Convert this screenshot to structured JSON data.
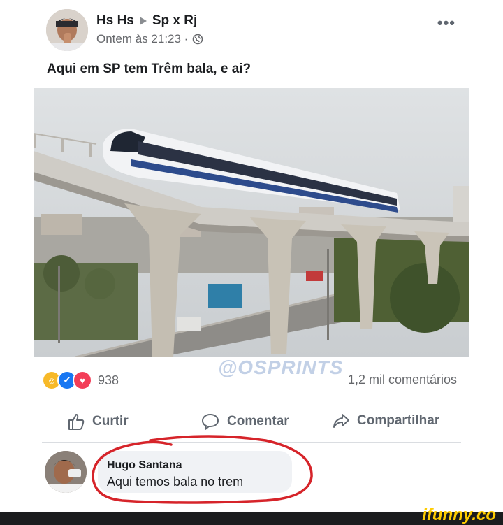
{
  "post": {
    "author": "Hs Hs",
    "group": "Sp x Rj",
    "time": "Ontem às 21:23 ·",
    "text": "Aqui em SP tem Trêm bala, e ai?",
    "more_icon": "more-icon"
  },
  "stats": {
    "reaction_icons": [
      "haha-icon",
      "like-icon",
      "love-icon"
    ],
    "reaction_count": "938",
    "comments": "1,2 mil comentários",
    "watermark": "@OSPRINTS"
  },
  "actions": {
    "like": "Curtir",
    "comment": "Comentar",
    "share": "Compartilhar"
  },
  "comment": {
    "name": "Hugo Santana",
    "text": "Aqui temos bala no trem"
  },
  "footer": {
    "brand": "ifunny.co"
  },
  "colors": {
    "text": "#1c1e21",
    "secondary": "#65676b",
    "annotation": "#d6242a",
    "footer": "#1b1c1e",
    "brand": "#ffcc00"
  }
}
